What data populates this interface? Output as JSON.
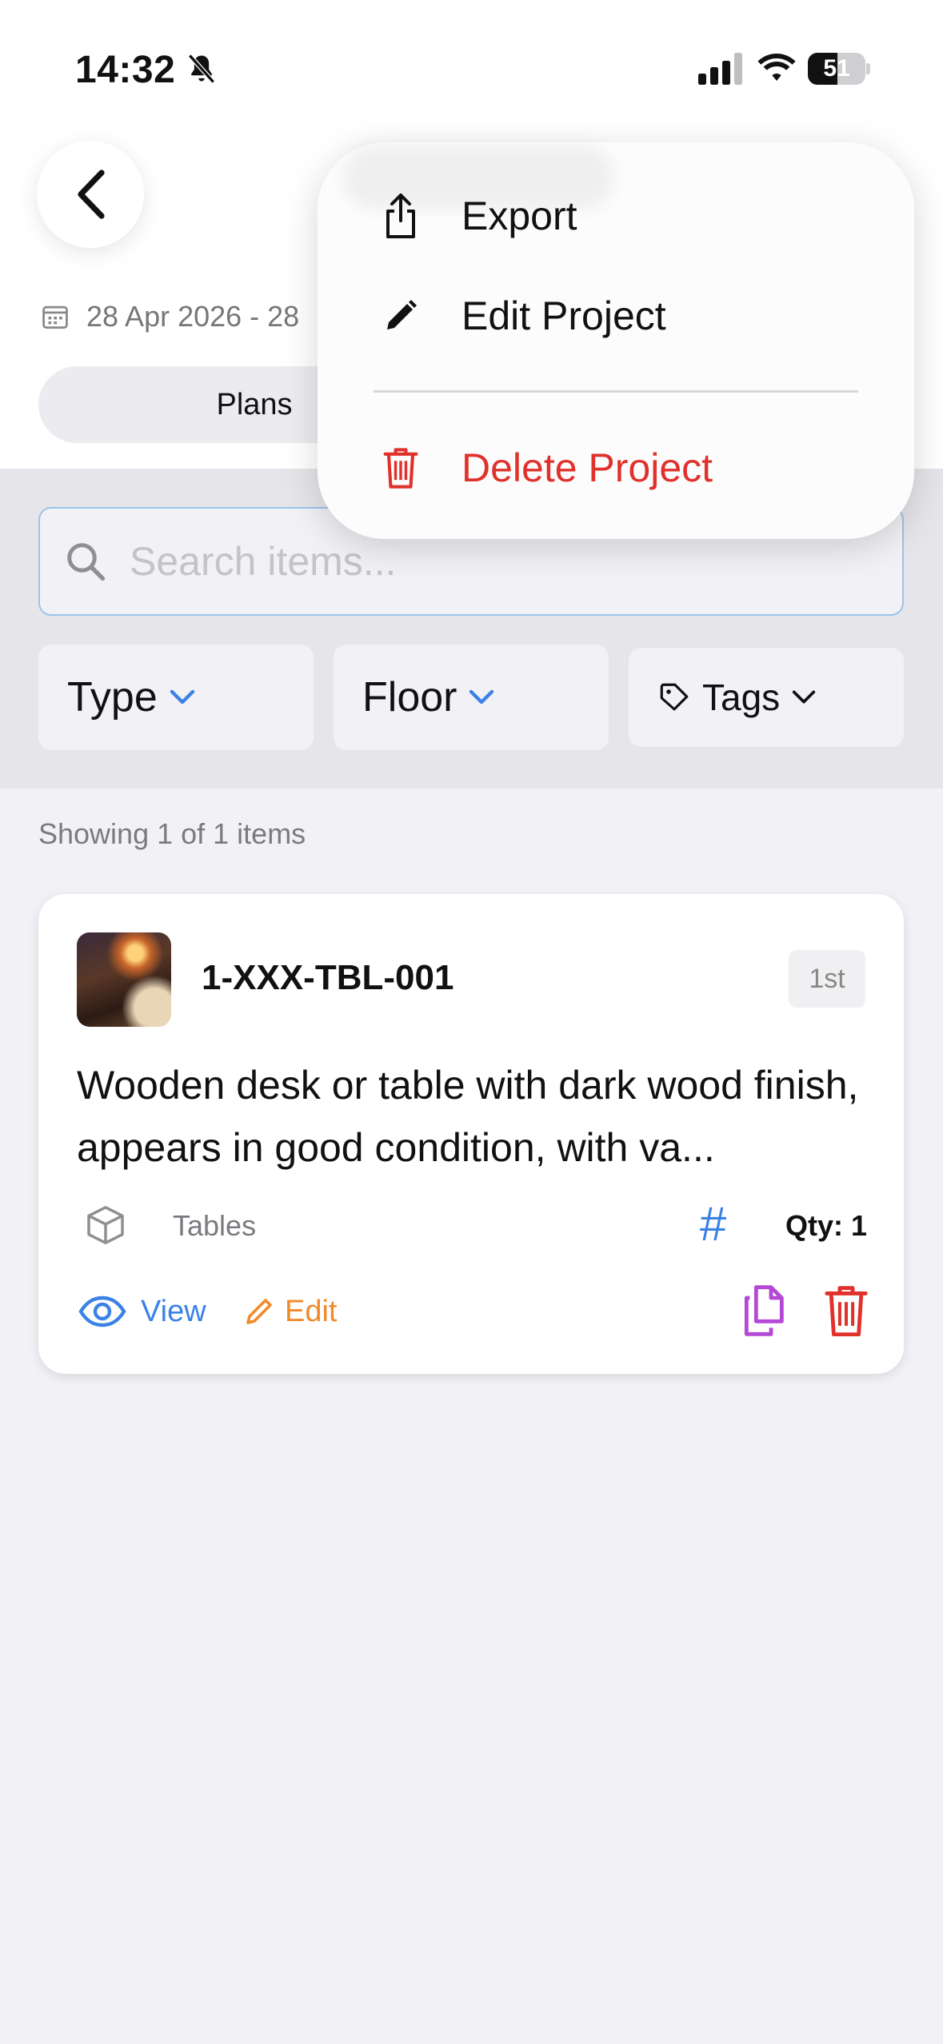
{
  "status_bar": {
    "time": "14:32",
    "battery": "51",
    "battery_level": 0.51
  },
  "header": {
    "date_range": "28 Apr 2026 - 28",
    "segment_plans": "Plans"
  },
  "search": {
    "placeholder": "Search items...",
    "value": ""
  },
  "filters": {
    "type": "Type",
    "floor": "Floor",
    "tags": "Tags"
  },
  "results": {
    "showing": "Showing 1 of 1 items"
  },
  "item": {
    "code": "1-XXX-TBL-001",
    "floor": "1st",
    "description": "Wooden desk or table with dark wood finish, appears in good condition, with va...",
    "category": "Tables",
    "hash": "#",
    "qty": "Qty: 1",
    "view_label": "View",
    "edit_label": "Edit"
  },
  "menu": {
    "export": "Export",
    "edit_project": "Edit Project",
    "delete_project": "Delete Project"
  },
  "colors": {
    "accent_blue": "#3a82e6",
    "edit_orange": "#f08a2c",
    "delete_red": "#e0312b",
    "duplicate_purple": "#b548d6"
  },
  "icons": [
    "bell-slash-icon",
    "signal-icon",
    "wifi-icon",
    "battery-icon",
    "chevron-left-icon",
    "calendar-icon",
    "search-icon",
    "chevron-down-icon",
    "tag-icon",
    "cube-icon",
    "eye-icon",
    "pencil-icon",
    "duplicate-icon",
    "trash-icon",
    "share-icon"
  ]
}
